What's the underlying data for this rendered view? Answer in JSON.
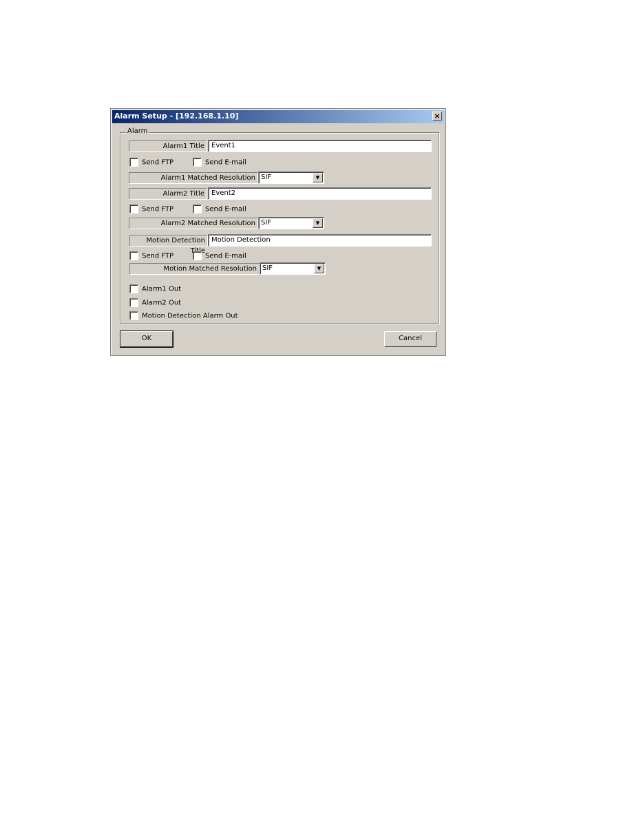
{
  "window": {
    "title": "Alarm Setup - [192.168.1.10]",
    "close_label": "×"
  },
  "group": {
    "legend": "Alarm"
  },
  "alarm1": {
    "title_label": "Alarm1 Title",
    "title_value": "Event1",
    "send_ftp": "Send FTP",
    "send_email": "Send E-mail",
    "resolution_label": "Alarm1 Matched Resolution",
    "resolution_value": "SIF"
  },
  "alarm2": {
    "title_label": "Alarm2 Title",
    "title_value": "Event2",
    "send_ftp": "Send FTP",
    "send_email": "Send E-mail",
    "resolution_label": "Alarm2 Matched Resolution",
    "resolution_value": "SIF"
  },
  "motion": {
    "title_label": "Motion Detection Title",
    "title_value": "Motion Detection",
    "send_ftp": "Send FTP",
    "send_email": "Send E-mail",
    "resolution_label": "Motion Matched Resolution",
    "resolution_value": "SIF"
  },
  "outputs": {
    "alarm1_out": "Alarm1 Out",
    "alarm2_out": "Alarm2 Out",
    "motion_out": "Motion Detection Alarm Out"
  },
  "buttons": {
    "ok": "OK",
    "cancel": "Cancel"
  },
  "icons": {
    "dropdown": "▼"
  }
}
